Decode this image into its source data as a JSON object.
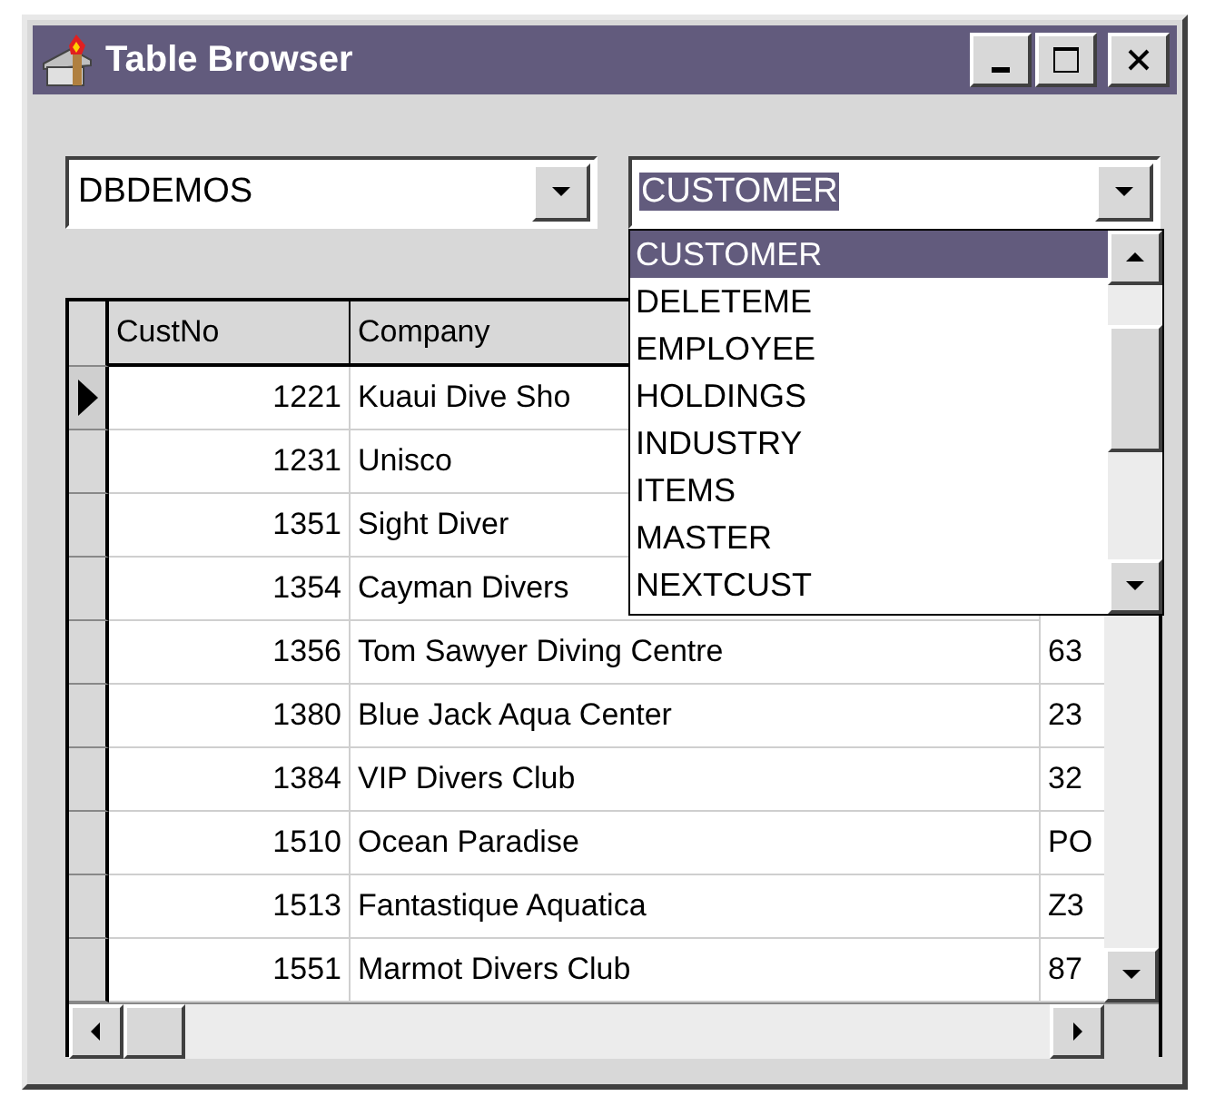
{
  "window": {
    "title": "Table Browser"
  },
  "database_combo": {
    "value": "DBDEMOS",
    "focused": false
  },
  "table_combo": {
    "value": "CUSTOMER",
    "focused": true
  },
  "table_list": [
    {
      "label": "CUSTOMER",
      "selected": true
    },
    {
      "label": "DELETEME",
      "selected": false
    },
    {
      "label": "EMPLOYEE",
      "selected": false
    },
    {
      "label": "HOLDINGS",
      "selected": false
    },
    {
      "label": "INDUSTRY",
      "selected": false
    },
    {
      "label": "ITEMS",
      "selected": false
    },
    {
      "label": "MASTER",
      "selected": false
    },
    {
      "label": "NEXTCUST",
      "selected": false
    }
  ],
  "grid": {
    "columns": [
      "CustNo",
      "Company"
    ],
    "rows": [
      {
        "current": true,
        "cells": [
          "1221",
          "Kuaui Dive Sho"
        ]
      },
      {
        "current": false,
        "cells": [
          "1231",
          "Unisco"
        ]
      },
      {
        "current": false,
        "cells": [
          "1351",
          "Sight Diver"
        ]
      },
      {
        "current": false,
        "cells": [
          "1354",
          "Cayman Divers"
        ]
      },
      {
        "current": false,
        "cells": [
          "1356",
          "Tom Sawyer Diving Centre",
          "63"
        ]
      },
      {
        "current": false,
        "cells": [
          "1380",
          "Blue Jack Aqua Center",
          "23"
        ]
      },
      {
        "current": false,
        "cells": [
          "1384",
          "VIP Divers Club",
          "32"
        ]
      },
      {
        "current": false,
        "cells": [
          "1510",
          "Ocean Paradise",
          "PO"
        ]
      },
      {
        "current": false,
        "cells": [
          "1513",
          "Fantastique Aquatica",
          "Z3"
        ]
      },
      {
        "current": false,
        "cells": [
          "1551",
          "Marmot Divers Club",
          "87"
        ]
      }
    ]
  }
}
